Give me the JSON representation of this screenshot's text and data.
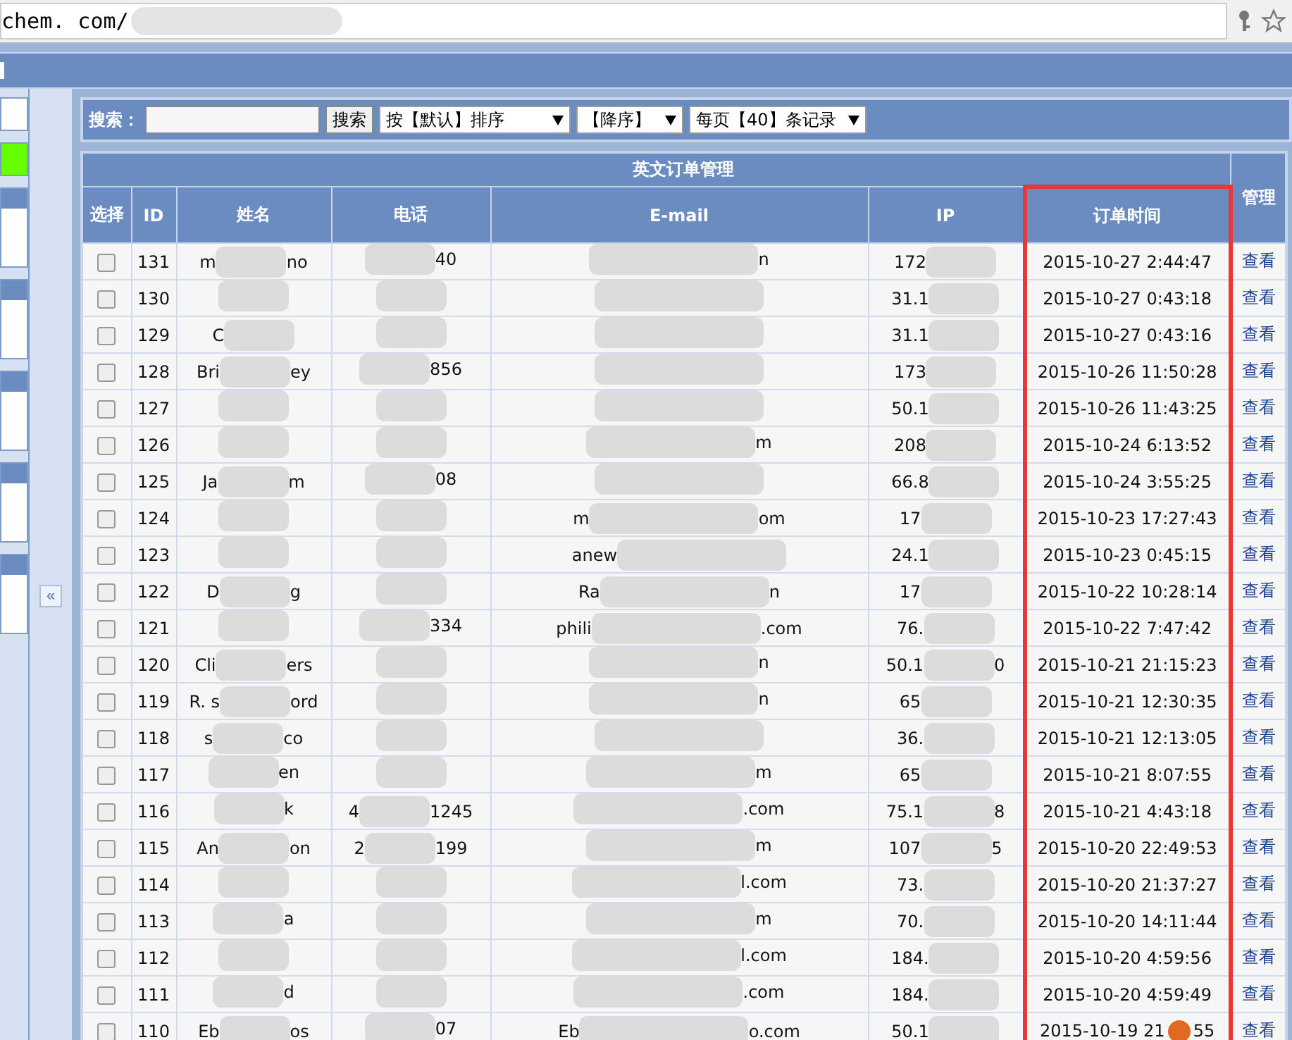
{
  "address_bar": {
    "url": "chem. com/"
  },
  "search": {
    "label": "搜索：",
    "button": "搜索",
    "sort_select": "按【默认】排序",
    "order_select": "【降序】",
    "page_size_select": "每页【40】条记录"
  },
  "collapse_button": "«",
  "table": {
    "title": "英文订单管理",
    "columns": [
      "选择",
      "ID",
      "姓名",
      "电话",
      "E-mail",
      "IP",
      "订单时间",
      "管理"
    ],
    "rows": [
      {
        "checked": false,
        "id": "131",
        "name": {
          "start": "m",
          "end": "no"
        },
        "phone": {
          "end": "40"
        },
        "email": {
          "end": "n"
        },
        "ip": {
          "start": "172"
        },
        "time": "2015-10-27 2:44:47",
        "action": "查看"
      },
      {
        "checked": false,
        "id": "130",
        "ip": {
          "start": "31.1"
        },
        "time": "2015-10-27 0:43:18",
        "action": "查看"
      },
      {
        "checked": false,
        "id": "129",
        "name": {
          "start": "C"
        },
        "ip": {
          "start": "31.1"
        },
        "time": "2015-10-27 0:43:16",
        "action": "查看"
      },
      {
        "checked": false,
        "id": "128",
        "name": {
          "start": "Bri",
          "end": "ey"
        },
        "phone": {
          "end": "856"
        },
        "ip": {
          "start": "173"
        },
        "time": "2015-10-26 11:50:28",
        "action": "查看"
      },
      {
        "checked": false,
        "id": "127",
        "ip": {
          "start": "50.1"
        },
        "time": "2015-10-26 11:43:25",
        "action": "查看"
      },
      {
        "checked": false,
        "id": "126",
        "email": {
          "end": "m"
        },
        "ip": {
          "start": "208"
        },
        "time": "2015-10-24 6:13:52",
        "action": "查看"
      },
      {
        "checked": false,
        "id": "125",
        "name": {
          "start": "Ja",
          "end": "m"
        },
        "phone": {
          "end": "08"
        },
        "ip": {
          "start": "66.8"
        },
        "time": "2015-10-24 3:55:25",
        "action": "查看"
      },
      {
        "checked": false,
        "id": "124",
        "email": {
          "start": "m",
          "end": "om"
        },
        "ip": {
          "start": "17"
        },
        "time": "2015-10-23 17:27:43",
        "action": "查看"
      },
      {
        "checked": false,
        "id": "123",
        "email": {
          "start": "anew"
        },
        "ip": {
          "start": "24.1"
        },
        "time": "2015-10-23 0:45:15",
        "action": "查看"
      },
      {
        "checked": false,
        "id": "122",
        "name": {
          "start": "D",
          "end": "g"
        },
        "email": {
          "start": "Ra",
          "end": "n"
        },
        "ip": {
          "start": "17"
        },
        "time": "2015-10-22 10:28:14",
        "action": "查看"
      },
      {
        "checked": false,
        "id": "121",
        "phone": {
          "end": "334"
        },
        "email": {
          "start": "phili",
          "end": ".com"
        },
        "ip": {
          "start": "76."
        },
        "time": "2015-10-22 7:47:42",
        "action": "查看"
      },
      {
        "checked": false,
        "id": "120",
        "name": {
          "start": "Cli",
          "end": "ers"
        },
        "email": {
          "end": "n"
        },
        "ip": {
          "start": "50.1",
          "end": "0"
        },
        "time": "2015-10-21 21:15:23",
        "action": "查看"
      },
      {
        "checked": false,
        "id": "119",
        "name": {
          "start": "R. s",
          "end": "ord"
        },
        "email": {
          "end": "n"
        },
        "ip": {
          "start": "65"
        },
        "time": "2015-10-21 12:30:35",
        "action": "查看"
      },
      {
        "checked": false,
        "id": "118",
        "name": {
          "start": "s",
          "end": "co"
        },
        "ip": {
          "start": "36."
        },
        "time": "2015-10-21 12:13:05",
        "action": "查看"
      },
      {
        "checked": false,
        "id": "117",
        "name": {
          "end": "en"
        },
        "email": {
          "end": "m"
        },
        "ip": {
          "start": "65"
        },
        "time": "2015-10-21 8:07:55",
        "action": "查看"
      },
      {
        "checked": false,
        "id": "116",
        "name": {
          "end": "k"
        },
        "phone": {
          "start": "4",
          "end": "1245"
        },
        "email": {
          "end": ".com"
        },
        "ip": {
          "start": "75.1",
          "end": "8"
        },
        "time": "2015-10-21 4:43:18",
        "action": "查看"
      },
      {
        "checked": false,
        "id": "115",
        "name": {
          "start": "An",
          "end": "on"
        },
        "phone": {
          "start": "2",
          "end": "199"
        },
        "email": {
          "end": "m"
        },
        "ip": {
          "start": "107",
          "end": "5"
        },
        "time": "2015-10-20 22:49:53",
        "action": "查看"
      },
      {
        "checked": false,
        "id": "114",
        "email": {
          "end": "l.com"
        },
        "ip": {
          "start": "73."
        },
        "time": "2015-10-20 21:37:27",
        "action": "查看"
      },
      {
        "checked": false,
        "id": "113",
        "name": {
          "end": "a"
        },
        "email": {
          "end": "m"
        },
        "ip": {
          "start": "70."
        },
        "time": "2015-10-20 14:11:44",
        "action": "查看"
      },
      {
        "checked": false,
        "id": "112",
        "email": {
          "end": "l.com"
        },
        "ip": {
          "start": "184."
        },
        "time": "2015-10-20 4:59:56",
        "action": "查看"
      },
      {
        "checked": false,
        "id": "111",
        "name": {
          "end": "d"
        },
        "email": {
          "end": ".com"
        },
        "ip": {
          "start": "184."
        },
        "time": "2015-10-20 4:59:49",
        "action": "查看"
      },
      {
        "checked": false,
        "id": "110",
        "name": {
          "start": "Eb",
          "end": "os"
        },
        "phone": {
          "end": "07"
        },
        "email": {
          "start": "Eb",
          "end": "o.com"
        },
        "ip": {
          "start": "50.1"
        },
        "time": "2015-10-19 21",
        "time_end": "55",
        "action": "查看"
      }
    ]
  }
}
